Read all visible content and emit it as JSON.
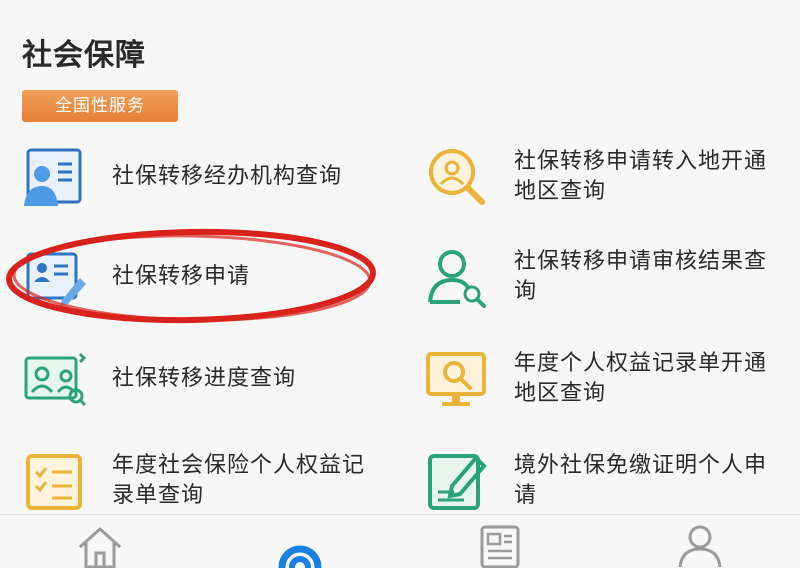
{
  "header": {
    "title": "社会保障"
  },
  "section": {
    "badge_label": "全国性服务"
  },
  "services": [
    {
      "label": "社保转移经办机构查询",
      "icon": "staff-document-icon"
    },
    {
      "label": "社保转移申请转入地开通地区查询",
      "icon": "magnifier-user-icon"
    },
    {
      "label": "社保转移申请",
      "icon": "form-edit-icon"
    },
    {
      "label": "社保转移申请审核结果查询",
      "icon": "user-search-icon"
    },
    {
      "label": "社保转移进度查询",
      "icon": "progress-card-icon"
    },
    {
      "label": "年度个人权益记录单开通地区查询",
      "icon": "monitor-search-icon"
    },
    {
      "label": "年度社会保险个人权益记录单查询",
      "icon": "checklist-icon"
    },
    {
      "label": "境外社保免缴证明个人申请",
      "icon": "certificate-edit-icon"
    }
  ],
  "highlight": {
    "color": "#d9221c"
  },
  "tabbar": {
    "items": [
      {
        "icon": "home-icon"
      },
      {
        "icon": "service-icon",
        "active": true
      },
      {
        "icon": "news-icon"
      },
      {
        "icon": "profile-icon"
      }
    ],
    "active_color": "#1a7fe0"
  }
}
